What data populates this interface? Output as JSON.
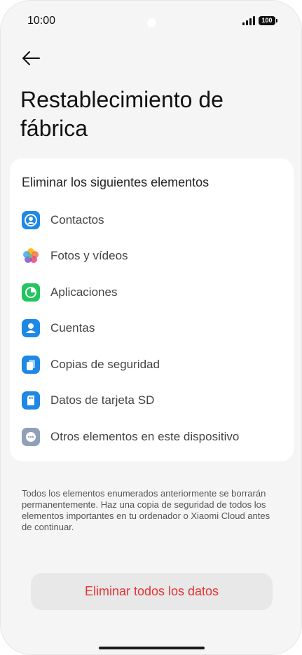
{
  "status_bar": {
    "time": "10:00",
    "battery": "100"
  },
  "page": {
    "title": "Restablecimiento de fábrica"
  },
  "card": {
    "heading": "Eliminar los siguientes elementos",
    "items": [
      {
        "label": "Contactos",
        "icon": "contacts-icon",
        "color": "#1e88e5"
      },
      {
        "label": "Fotos y vídeos",
        "icon": "gallery-icon",
        "color": "#ff7043"
      },
      {
        "label": "Aplicaciones",
        "icon": "apps-icon",
        "color": "#22c55e"
      },
      {
        "label": "Cuentas",
        "icon": "account-icon",
        "color": "#1e88e5"
      },
      {
        "label": "Copias de seguridad",
        "icon": "backup-icon",
        "color": "#1e88e5"
      },
      {
        "label": "Datos de tarjeta SD",
        "icon": "sd-card-icon",
        "color": "#1e88e5"
      },
      {
        "label": "Otros elementos en este dispositivo",
        "icon": "more-icon",
        "color": "#8fa0b8"
      }
    ]
  },
  "note": "Todos los elementos enumerados anteriormente se borrarán permanentemente. Haz una copia de seguridad de todos los elementos importantes en tu ordenador o Xiaomi Cloud antes de continuar.",
  "actions": {
    "erase_label": "Eliminar todos los datos"
  },
  "colors": {
    "danger": "#e63232",
    "background": "#f5f5f5",
    "card": "#ffffff"
  }
}
